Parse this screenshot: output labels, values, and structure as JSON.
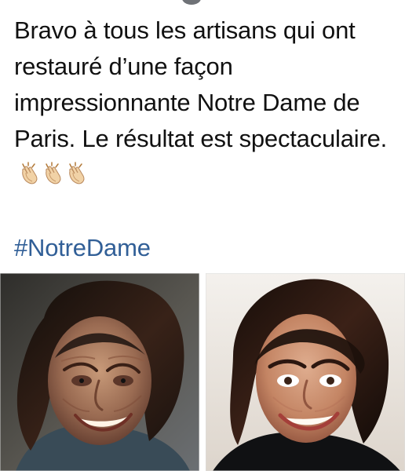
{
  "post": {
    "body_text": "Bravo à tous les artisans qui ont restauré d’une façon impressionnante Notre Dame de Paris. Le résultat est spectaculaire.",
    "emojis": [
      "clapping-hands-icon",
      "clapping-hands-icon",
      "clapping-hands-icon"
    ],
    "hashtag": "#NotreDame"
  },
  "colors": {
    "text": "#111111",
    "hashtag": "#315f97"
  }
}
